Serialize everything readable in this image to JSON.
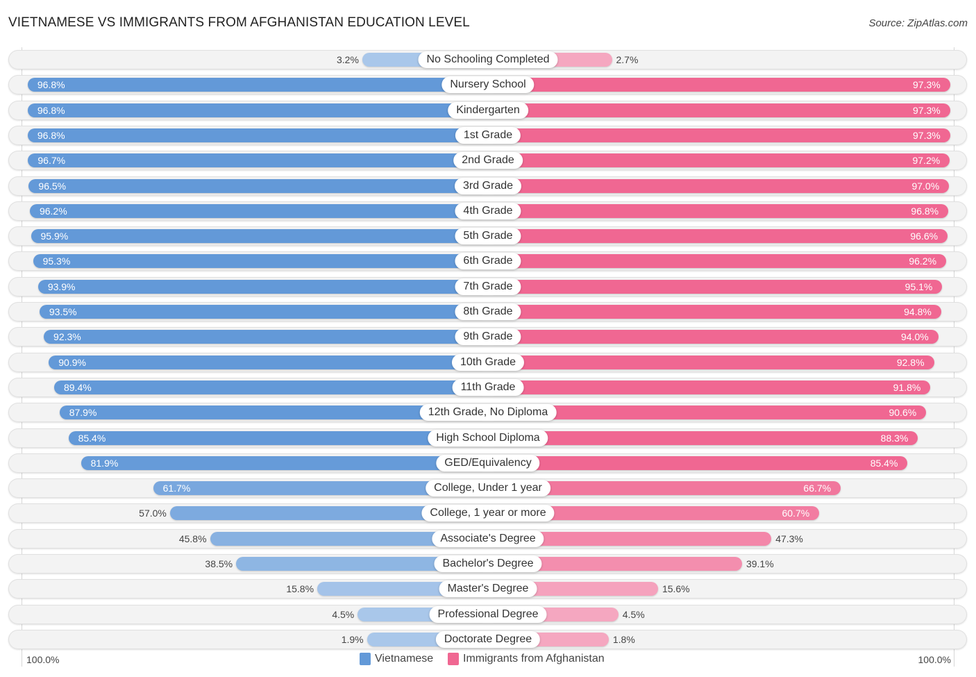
{
  "header": {
    "title": "VIETNAMESE VS IMMIGRANTS FROM AFGHANISTAN EDUCATION LEVEL",
    "source": "Source: ZipAtlas.com"
  },
  "colors": {
    "left_strong": "#6399d8",
    "left_light": "#a9c7ea",
    "right_strong": "#f06792",
    "right_light": "#f5a7c0"
  },
  "chart_data": {
    "type": "bar",
    "orientation": "horizontal-diverging",
    "title": "VIETNAMESE VS IMMIGRANTS FROM AFGHANISTAN EDUCATION LEVEL",
    "xlabel": "",
    "ylabel": "",
    "xlim": [
      0,
      100
    ],
    "axis_labels": {
      "left": "100.0%",
      "right": "100.0%"
    },
    "legend_position": "bottom-center",
    "unit": "%",
    "categories": [
      "No Schooling Completed",
      "Nursery School",
      "Kindergarten",
      "1st Grade",
      "2nd Grade",
      "3rd Grade",
      "4th Grade",
      "5th Grade",
      "6th Grade",
      "7th Grade",
      "8th Grade",
      "9th Grade",
      "10th Grade",
      "11th Grade",
      "12th Grade, No Diploma",
      "High School Diploma",
      "GED/Equivalency",
      "College, Under 1 year",
      "College, 1 year or more",
      "Associate's Degree",
      "Bachelor's Degree",
      "Master's Degree",
      "Professional Degree",
      "Doctorate Degree"
    ],
    "series": [
      {
        "name": "Vietnamese",
        "side": "left",
        "values": [
          3.2,
          96.8,
          96.8,
          96.8,
          96.7,
          96.5,
          96.2,
          95.9,
          95.3,
          93.9,
          93.5,
          92.3,
          90.9,
          89.4,
          87.9,
          85.4,
          81.9,
          61.7,
          57.0,
          45.8,
          38.5,
          15.8,
          4.5,
          1.9
        ],
        "labels": [
          "3.2%",
          "96.8%",
          "96.8%",
          "96.8%",
          "96.7%",
          "96.5%",
          "96.2%",
          "95.9%",
          "95.3%",
          "93.9%",
          "93.5%",
          "92.3%",
          "90.9%",
          "89.4%",
          "87.9%",
          "85.4%",
          "81.9%",
          "61.7%",
          "57.0%",
          "45.8%",
          "38.5%",
          "15.8%",
          "4.5%",
          "1.9%"
        ]
      },
      {
        "name": "Immigrants from Afghanistan",
        "side": "right",
        "values": [
          2.7,
          97.3,
          97.3,
          97.3,
          97.2,
          97.0,
          96.8,
          96.6,
          96.2,
          95.1,
          94.8,
          94.0,
          92.8,
          91.8,
          90.6,
          88.3,
          85.4,
          66.7,
          60.7,
          47.3,
          39.1,
          15.6,
          4.5,
          1.8
        ],
        "labels": [
          "2.7%",
          "97.3%",
          "97.3%",
          "97.3%",
          "97.2%",
          "97.0%",
          "96.8%",
          "96.6%",
          "96.2%",
          "95.1%",
          "94.8%",
          "94.0%",
          "92.8%",
          "91.8%",
          "90.6%",
          "88.3%",
          "85.4%",
          "66.7%",
          "60.7%",
          "47.3%",
          "39.1%",
          "15.6%",
          "4.5%",
          "1.8%"
        ]
      }
    ]
  },
  "legend": {
    "items": [
      {
        "label": "Vietnamese",
        "color": "#6399d8"
      },
      {
        "label": "Immigrants from Afghanistan",
        "color": "#f06792"
      }
    ]
  }
}
